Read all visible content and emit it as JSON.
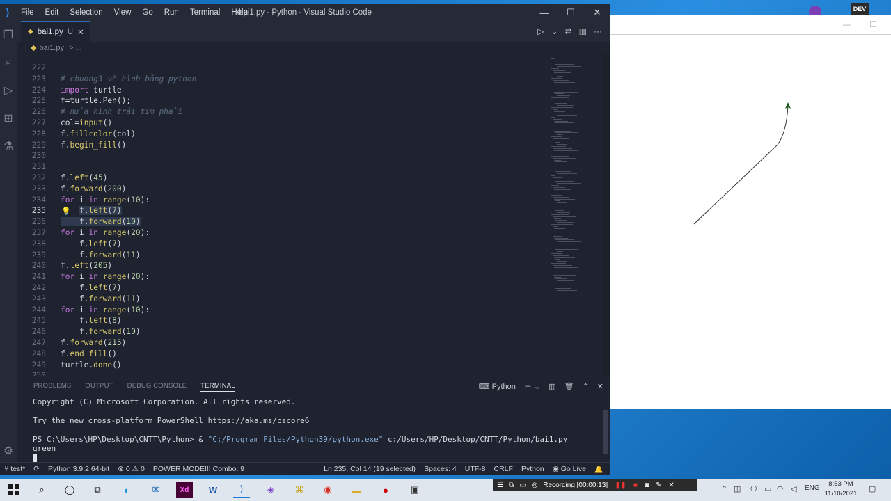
{
  "vscode": {
    "menu": [
      "File",
      "Edit",
      "Selection",
      "View",
      "Go",
      "Run",
      "Terminal",
      "Help"
    ],
    "window_title": "bai1.py - Python - Visual Studio Code",
    "tab": {
      "label": "bai1.py",
      "status": "U"
    },
    "breadcrumb": "bai1.py",
    "breadcrumb_more": "> ...",
    "code_lines": [
      {
        "n": "222",
        "html": ""
      },
      {
        "n": "223",
        "html": "<span class='cm'># chuong3 vẽ hình bằng python</span>"
      },
      {
        "n": "224",
        "html": "<span class='kw'>import</span> <span class='id'>turtle</span>"
      },
      {
        "n": "225",
        "html": "<span class='id'>f</span>=<span class='id'>turtle</span>.<span class='id'>Pen</span>();"
      },
      {
        "n": "226",
        "html": "<span class='cm'># nửa hình trái tim phải</span>"
      },
      {
        "n": "227",
        "html": "<span class='id'>col</span>=<span class='fn'>input</span>()"
      },
      {
        "n": "228",
        "html": "<span class='id'>f</span>.<span class='fn'>fillcolor</span>(<span class='id'>col</span>)"
      },
      {
        "n": "229",
        "html": "<span class='id'>f</span>.<span class='fn'>begin_fill</span>()"
      },
      {
        "n": "230",
        "html": ""
      },
      {
        "n": "231",
        "html": ""
      },
      {
        "n": "232",
        "html": "<span class='id'>f</span>.<span class='fn'>left</span>(<span class='num'>45</span>)"
      },
      {
        "n": "233",
        "html": "<span class='id'>f</span>.<span class='fn'>forward</span>(<span class='num'>200</span>)"
      },
      {
        "n": "234",
        "html": "<span class='kw'>for</span> <span class='id'>i</span> <span class='kw'>in</span> <span class='fn'>range</span>(<span class='num'>10</span>):"
      },
      {
        "n": "235",
        "html": "    <span class='sel'><span class='id'>f</span>.<span class='fn'>left</span>(<span class='num'>7</span>)</span>",
        "current": true
      },
      {
        "n": "236",
        "html": "<span class='sel'>    <span class='id'>f</span>.<span class='fn'>forward</span>(<span class='num'>10</span>)</span>"
      },
      {
        "n": "237",
        "html": "<span class='kw'>for</span> <span class='id'>i</span> <span class='kw'>in</span> <span class='fn'>range</span>(<span class='num'>20</span>):"
      },
      {
        "n": "238",
        "html": "    <span class='id'>f</span>.<span class='fn'>left</span>(<span class='num'>7</span>)"
      },
      {
        "n": "239",
        "html": "    <span class='id'>f</span>.<span class='fn'>forward</span>(<span class='num'>11</span>)"
      },
      {
        "n": "240",
        "html": "<span class='id'>f</span>.<span class='fn'>left</span>(<span class='num'>205</span>)"
      },
      {
        "n": "241",
        "html": "<span class='kw'>for</span> <span class='id'>i</span> <span class='kw'>in</span> <span class='fn'>range</span>(<span class='num'>20</span>):"
      },
      {
        "n": "242",
        "html": "    <span class='id'>f</span>.<span class='fn'>left</span>(<span class='num'>7</span>)"
      },
      {
        "n": "243",
        "html": "    <span class='id'>f</span>.<span class='fn'>forward</span>(<span class='num'>11</span>)"
      },
      {
        "n": "244",
        "html": "<span class='kw'>for</span> <span class='id'>i</span> <span class='kw'>in</span> <span class='fn'>range</span>(<span class='num'>10</span>):"
      },
      {
        "n": "245",
        "html": "    <span class='id'>f</span>.<span class='fn'>left</span>(<span class='num'>8</span>)"
      },
      {
        "n": "246",
        "html": "    <span class='id'>f</span>.<span class='fn'>forward</span>(<span class='num'>10</span>)"
      },
      {
        "n": "247",
        "html": "<span class='id'>f</span>.<span class='fn'>forward</span>(<span class='num'>215</span>)"
      },
      {
        "n": "248",
        "html": "<span class='id'>f</span>.<span class='fn'>end_fill</span>()"
      },
      {
        "n": "249",
        "html": "<span class='id'>turtle</span>.<span class='fn'>done</span>()"
      },
      {
        "n": "250",
        "html": ""
      }
    ],
    "panel": {
      "tabs": [
        "PROBLEMS",
        "OUTPUT",
        "DEBUG CONSOLE",
        "TERMINAL"
      ],
      "active_tab": "TERMINAL",
      "shell": "Python",
      "terminal_lines": [
        "Copyright (C) Microsoft Corporation. All rights reserved.",
        "",
        "Try the new cross-platform PowerShell https://aka.ms/pscore6",
        "",
        "PS C:\\Users\\HP\\Desktop\\CNTT\\Python> & ",
        "green"
      ],
      "cmd_exe": "\"C:/Program Files/Python39/python.exe\"",
      "cmd_arg": " c:/Users/HP/Desktop/CNTT/Python/bai1.py"
    },
    "status": {
      "branch": "test*",
      "interpreter": "Python 3.9.2 64-bit",
      "errors": "0",
      "warnings": "0",
      "power_mode": "POWER MODE!!! Combo: 9",
      "position": "Ln 235, Col 14 (19 selected)",
      "spaces": "Spaces: 4",
      "encoding": "UTF-8",
      "eol": "CRLF",
      "language": "Python",
      "golive": "Go Live"
    }
  },
  "turtle": {
    "pen_color": "#333333",
    "arrow_color": "#1a5c1a"
  },
  "taskbar": {
    "recording": "Recording [00:00:13]",
    "lang": "ENG",
    "time": "8:53 PM",
    "date": "11/10/2021"
  },
  "tray_top": {
    "dev_label": "DEV"
  }
}
